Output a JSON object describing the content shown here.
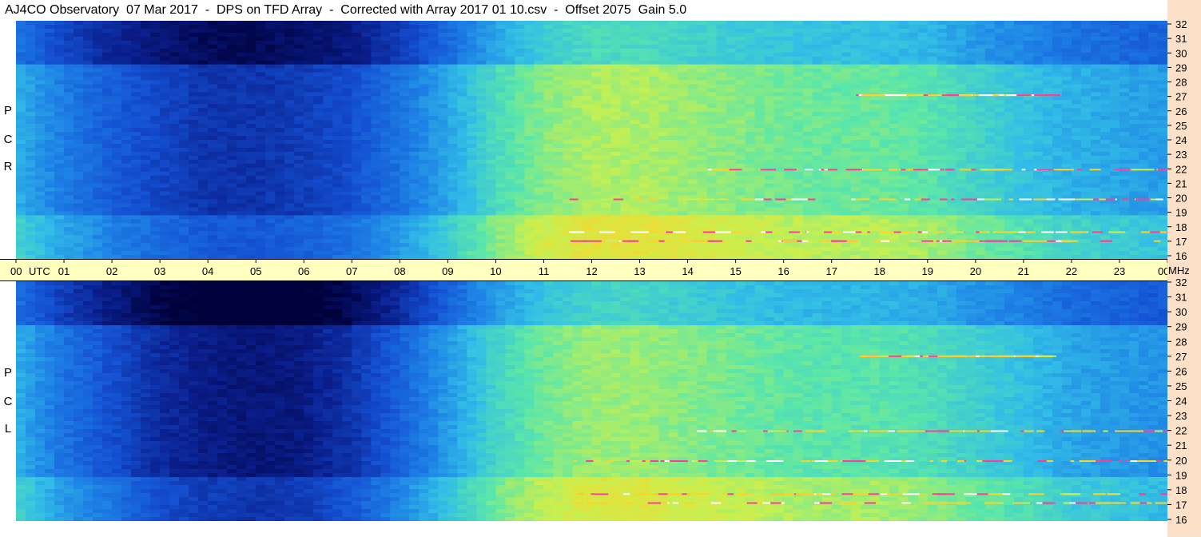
{
  "title": "AJ4CO Observatory  07 Mar 2017  -  DPS on TFD Array  -  Corrected with Array 2017 01 10.csv  -  Offset 2075  Gain 5.0",
  "colors": {
    "time_axis_bg": "#ffffbf",
    "freq_axis_bg": "#fde0c8",
    "colormap": [
      "#00003a",
      "#0a1e8c",
      "#1450d2",
      "#1e82e6",
      "#32bee6",
      "#5ae6aa",
      "#c8f050",
      "#ffd228",
      "#ff3c96",
      "#ffffff"
    ]
  },
  "panels": {
    "rcp": {
      "label_letters": [
        "R",
        "C",
        "P"
      ]
    },
    "lcp": {
      "label_letters": [
        "L",
        "C",
        "P"
      ]
    }
  },
  "chart_data": {
    "type": "heatmap",
    "title": "AJ4CO Observatory  07 Mar 2017  -  DPS on TFD Array  -  Corrected with Array 2017 01 10.csv  -  Offset 2075  Gain 5.0",
    "x": {
      "tick_labels": [
        "00",
        "01",
        "02",
        "03",
        "04",
        "05",
        "06",
        "07",
        "08",
        "09",
        "10",
        "11",
        "12",
        "13",
        "14",
        "15",
        "16",
        "17",
        "18",
        "19",
        "20",
        "21",
        "22",
        "23",
        "00"
      ],
      "unit_label": "UTC",
      "range": [
        0,
        24
      ]
    },
    "y": {
      "tick_labels": [
        "32",
        "31",
        "30",
        "29",
        "28",
        "27",
        "26",
        "25",
        "24",
        "23",
        "22",
        "21",
        "20",
        "19",
        "18",
        "17",
        "16"
      ],
      "unit_label": "MHz",
      "range": [
        16,
        32
      ]
    },
    "series": [
      {
        "name": "RCP",
        "intensity_profile_by_hour": [
          0.42,
          0.32,
          0.25,
          0.2,
          0.16,
          0.16,
          0.18,
          0.22,
          0.3,
          0.4,
          0.52,
          0.6,
          0.64,
          0.64,
          0.62,
          0.6,
          0.58,
          0.57,
          0.57,
          0.55,
          0.5,
          0.46,
          0.42,
          0.4,
          0.38
        ]
      },
      {
        "name": "LCP",
        "intensity_profile_by_hour": [
          0.42,
          0.3,
          0.22,
          0.14,
          0.1,
          0.08,
          0.1,
          0.16,
          0.26,
          0.38,
          0.5,
          0.58,
          0.62,
          0.62,
          0.6,
          0.58,
          0.56,
          0.55,
          0.55,
          0.53,
          0.49,
          0.45,
          0.4,
          0.38,
          0.36
        ]
      }
    ],
    "bright_bands_mhz": [
      17.2,
      17.8,
      20.0,
      22.0,
      27.0
    ]
  }
}
